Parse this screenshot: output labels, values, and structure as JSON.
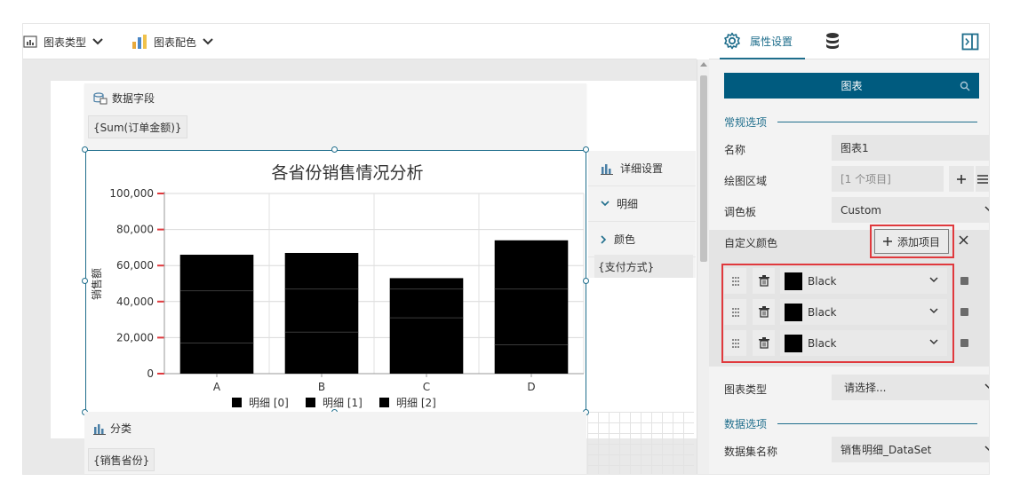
{
  "toolbar": {
    "chart_type_label": "图表类型",
    "chart_color_label": "图表配色"
  },
  "panel_top": {
    "title": "数据字段",
    "chip": "{Sum(订单金额)}"
  },
  "panel_bottom": {
    "title": "分类",
    "chip": "{销售省份}"
  },
  "side_panel": {
    "title": "详细设置",
    "detail_label": "明细",
    "color_label": "颜色",
    "chip": "{支付方式}"
  },
  "chart_data": {
    "type": "bar",
    "title": "各省份销售情况分析",
    "ylabel": "销售额",
    "xlabel": "",
    "categories": [
      "A",
      "B",
      "C",
      "D"
    ],
    "ylim": [
      0,
      100000
    ],
    "y_ticks": [
      "0",
      "20,000",
      "40,000",
      "60,000",
      "80,000",
      "100,000"
    ],
    "series": [
      {
        "name": "明细 [0]",
        "values": [
          17000,
          23000,
          31000,
          16000
        ]
      },
      {
        "name": "明细 [1]",
        "values": [
          29000,
          24000,
          16000,
          31000
        ]
      },
      {
        "name": "明细 [2]",
        "values": [
          20000,
          20000,
          6000,
          27000
        ]
      }
    ],
    "series_color": "#000000",
    "segment_line_color": "#3a3a3a",
    "grid": true,
    "legend_position": "bottom",
    "axis_tick_color": "#e0393d"
  },
  "right_panel": {
    "tab_properties": "属性设置",
    "search_label": "图表",
    "section_general": "常规选项",
    "name_label": "名称",
    "name_value": "图表1",
    "plot_area_label": "绘图区域",
    "plot_area_value": "[1 个项目]",
    "palette_label": "调色板",
    "palette_value": "Custom",
    "custom_colors_label": "自定义颜色",
    "add_item_label": "添加项目",
    "colors": [
      "Black",
      "Black",
      "Black"
    ],
    "chart_type_label": "图表类型",
    "chart_type_value": "请选择...",
    "section_data": "数据选项",
    "dataset_label": "数据集名称",
    "dataset_value": "销售明细_DataSet",
    "accent_color": "#1f6e8c",
    "highlight_color": "#e0393d"
  }
}
